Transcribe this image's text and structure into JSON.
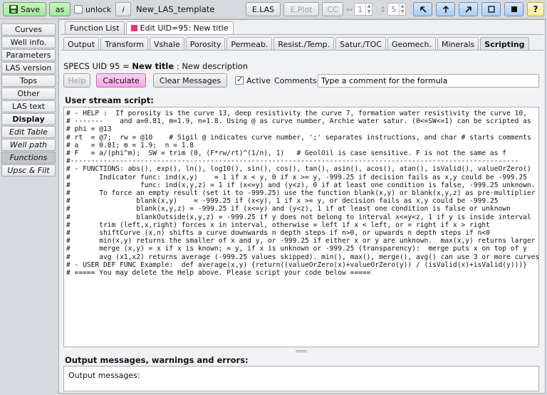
{
  "toolbar": {
    "save_label": "Save",
    "as_label": "as",
    "unlock_label": "unlock",
    "info_label": "i",
    "template_name": "New_LAS_template",
    "elas_label": "E.LAS",
    "eplot_label": "E.Plot",
    "cc_label": "CC",
    "spin1_value": "1",
    "spin2_value": "5",
    "help_label": "?",
    "colors": {
      "green": "#a4e89c",
      "blue": "#a9cdf3",
      "yellow": "#f5ec8e",
      "pink": "#f6a4e6"
    }
  },
  "sidebar": {
    "items": [
      {
        "label": "Curves"
      },
      {
        "label": "Well info."
      },
      {
        "label": "Parameters"
      },
      {
        "label": "LAS version"
      },
      {
        "label": "Tops"
      },
      {
        "label": "Other"
      },
      {
        "label": "LAS text"
      },
      {
        "label": "Display"
      },
      {
        "label": "Edit Table"
      },
      {
        "label": "Well path"
      },
      {
        "label": "Functions"
      },
      {
        "label": "Upsc & Filt"
      }
    ]
  },
  "top_tabs": [
    {
      "label": "Function List"
    },
    {
      "label": "Edit UID=95: New title"
    }
  ],
  "sub_tabs": [
    {
      "label": "Output"
    },
    {
      "label": "Transform"
    },
    {
      "label": "Vshale"
    },
    {
      "label": "Porosity"
    },
    {
      "label": "Permeab."
    },
    {
      "label": "Resist./Temp."
    },
    {
      "label": "Satur./TOC"
    },
    {
      "label": "Geomech."
    },
    {
      "label": "Minerals"
    },
    {
      "label": "Scripting"
    }
  ],
  "specs": {
    "prefix": "SPECS UID 95 = ",
    "title": "New title",
    "separator": " : ",
    "description": "New description"
  },
  "controls": {
    "help_label": "Help",
    "calculate_label": "Calculate",
    "clear_label": "Clear Messages",
    "active_label": "Active",
    "comments_label": "Comments:",
    "comment_value": "Type a comment for the formula"
  },
  "script": {
    "title": "User stream script:",
    "text": "# - HELP :  If porosity is the curve 13, deep resistivity the curve 7, formation water resistivity the curve 10,\n# -------    and a=0.81, m=1.9, n=1.8. Using @ as curve number, Archie water satur. (0<=SW<=1) can be scripted as\n# phi = @13\n# rt  = @7;  rw = @10    # Sigil @ indicates curve number, ';' separates instructions, and char # starts comments\n# a   = 0.81; m = 1.9;  n = 1.8\n# F   = a/(phi^m);  SW = trim (0, (F*rw/rt)^(1/n), 1)   # GeolOil is case sensitive. F is not the same as f\n#-------------------------------------------------------------------------------------------------------------\n# - FUNCTIONS: abs(), exp(), ln(), log10(), sin(), cos(), tan(), asin(), acos(), atan(), isValid(), valueOrZero()\n#       Indicator func: ind(x,y)    = 1 if x < y, 0 if x >= y, -999.25 if decision fails as x,y could be -999.25\n#                 func: ind(x,y,z) = 1 if (x<=y) and (y<z), 0 if at least one condition is false, -999.25 unknown.\n#       To force an empty result (set it to -999.25) use the function blank(x,y) or blank(x,y,z) as pre-multiplier\n#                blank(x,y)    = -999.25 if (x<y), 1 if x >= y, or decision fails as x,y could be -999.25\n#                blank(x,y,z) = -999.25 if (x<=y) and (y<z), 1 if at least one condition is false or unknown\n#                blankOutside(x,y,z) = -999.25 if y does not belong to interval x<=y<z, 1 if y is inside interval\n#       trim (left,x,right) forces x in interval, otherwise = left if x < left, or = right if x > right\n#       shiftCurve (x,n) shifts a curve downwards n depth steps if n>0, or upwards n depth steps if n<0\n#       min(x,y) returns the smaller of x and y, or -999.25 if either x or y are unknown.  max(x,y) returns larger\n#       merge (x,y) = x if x is known; = y, if x is unknown or -999.25 (transparency):  merge puts x on top of y\n#       avg (x1,x2) returns average (-999.25 values skipped). min(), max(), merge(), avg() can use 3 or more curves\n# - USER DEF FUNC Example:  def average(x,y) {return((valueOrZero(x)+valueOrZero(y)) / (isValid(x)+isValid(y)))}\n# ===== You may delete the Help above. Please script your code below ====="
  },
  "output": {
    "title": "Output messages, warnings and errors:",
    "text": "Output messages:"
  }
}
